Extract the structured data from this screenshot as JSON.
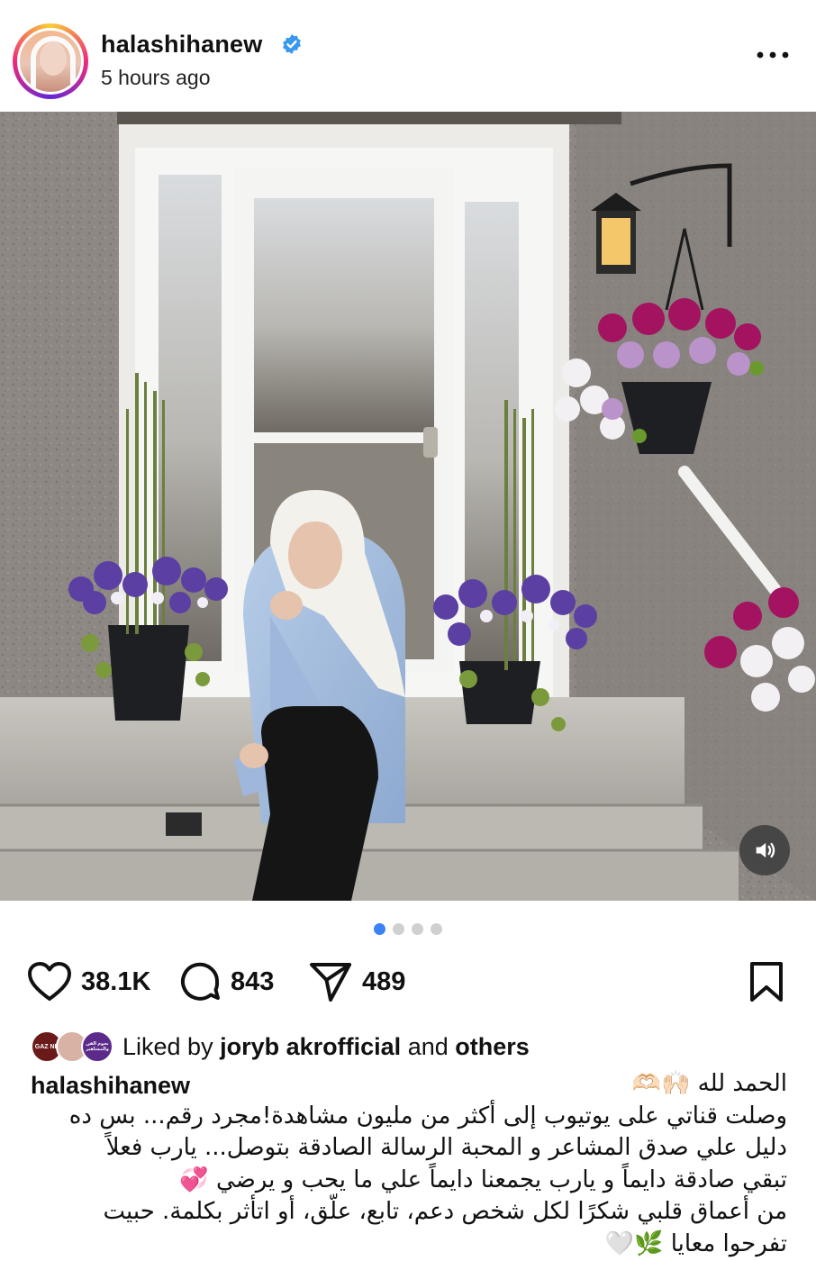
{
  "post": {
    "username": "halashihanew",
    "time": "5 hours ago",
    "more_icon": "more-horizontal-icon"
  },
  "carousel": {
    "count": 4,
    "active_index": 0
  },
  "actions": {
    "likes": "38.1K",
    "comments": "843",
    "shares": "489"
  },
  "liked_by": {
    "prefix": "Liked by",
    "user": "joryb akrofficial",
    "connector": "and",
    "others": "others",
    "mini_avatar_labels": [
      "GAZ NE",
      "نجوم الفن والمشاهير"
    ]
  },
  "caption": {
    "username": "halashihanew",
    "lines": [
      "الحمد لله 🙌🏻🫶🏻",
      "وصلت قناتي على يوتيوب إلى أكثر من مليون مشاهدة!مجرد رقم... بس ده",
      "دليل علي صدق المشاعر و المحبة الرسالة الصادقة بتوصل... يارب فعلاً",
      "تبقي صادقة دايماً و يارب يجمعنا دايماً علي ما يحب و يرضي 💞",
      "من أعماق قلبي شكرًا لكل شخص دعم، تابع، علّق، أو اتأثر بكلمة. حبيت",
      "تفرحوا معايا 🌿🤍"
    ]
  },
  "colors": {
    "accent": "#3b82f6",
    "verified": "#3897f0",
    "text": "#111111"
  }
}
